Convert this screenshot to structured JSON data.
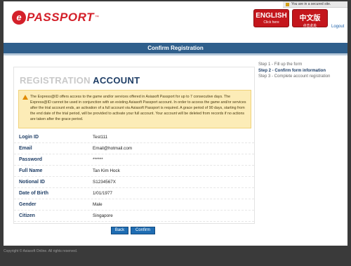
{
  "header": {
    "logo_prefix": "e",
    "logo_text": "PASSPORT",
    "logo_tm": "™",
    "secure_text": "You are in a secured site.",
    "lang_english_main": "ENGLISH",
    "lang_english_sub": "Click here",
    "lang_chinese_main": "中文版",
    "lang_chinese_sub": "点击此处",
    "logout": "Logout"
  },
  "title_bar": "Confirm Registration",
  "steps": [
    "Step 1 - Fill up the form",
    "Step 2 - Confirm form information",
    "Step 3 - Complete account registration"
  ],
  "registration": {
    "title_part1": "REGISTRATION",
    "title_part2": "ACCOUNT",
    "notice": "The Express@ID offers access to the game and/or services offered in Asiasoft Passport for up to 7 consecutive days. The Express@ID cannot be used in conjunction with an existing Asiasoft Passport account. In order to access the game and/or services after the trial account ends, an activation of a full account via Asiasoft Passport is required. A grace period of 90 days, starting from the end date of the trial period, will be provided to activate your full account. Your account will be deleted from records if no actions are taken after the grace period.",
    "fields": [
      {
        "label": "Login ID",
        "value": "Test111"
      },
      {
        "label": "Email",
        "value": "Email@hotmail.com"
      },
      {
        "label": "Password",
        "value": "******"
      },
      {
        "label": "Full Name",
        "value": "Tan Kim Hock"
      },
      {
        "label": "Notional ID",
        "value": "S1234567X"
      },
      {
        "label": "Date of Birth",
        "value": "1/01/1977"
      },
      {
        "label": "Gender",
        "value": "Male"
      },
      {
        "label": "Citizen",
        "value": "Singapore"
      }
    ]
  },
  "buttons": {
    "back": "Back",
    "confirm": "Confirm"
  },
  "footer": "Copyright © Asiasoft Online. All rights reserved.",
  "colors": {
    "brand_red": "#d4202a",
    "title_bar": "#2f5f8c",
    "label_navy": "#1f3e66",
    "notice_bg": "#fcecb7",
    "button_blue": "#1f6db3"
  }
}
